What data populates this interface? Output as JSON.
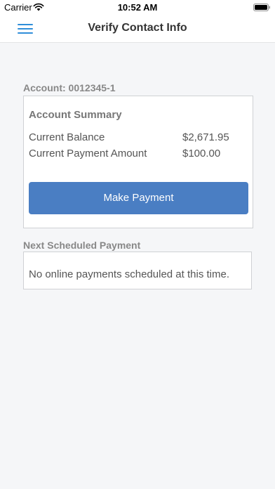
{
  "status_bar": {
    "carrier": "Carrier",
    "time": "10:52 AM"
  },
  "nav": {
    "title": "Verify Contact Info",
    "menu_icon": "hamburger-menu-icon"
  },
  "account": {
    "heading": "Account: 0012345-1"
  },
  "summary": {
    "title": "Account Summary",
    "rows": [
      {
        "label": "Current Balance",
        "value": "$2,671.95"
      },
      {
        "label": "Current Payment Amount",
        "value": "$100.00"
      }
    ],
    "button_label": "Make Payment"
  },
  "scheduled": {
    "heading": "Next Scheduled Payment",
    "message": "No online payments scheduled at this time."
  },
  "colors": {
    "accent": "#2f8ed9",
    "button": "#4a7ec3",
    "background": "#f5f6f8"
  }
}
